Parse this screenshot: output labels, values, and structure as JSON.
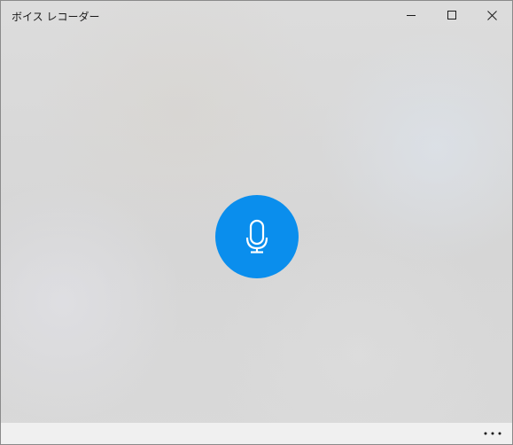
{
  "window": {
    "title": "ボイス レコーダー",
    "controls": {
      "minimize_icon": "minimize-icon",
      "maximize_icon": "maximize-icon",
      "close_icon": "close-icon"
    }
  },
  "main": {
    "record_icon": "microphone-icon",
    "accent_color": "#0a8eed"
  },
  "bottombar": {
    "more_icon": "more-ellipsis-icon"
  }
}
